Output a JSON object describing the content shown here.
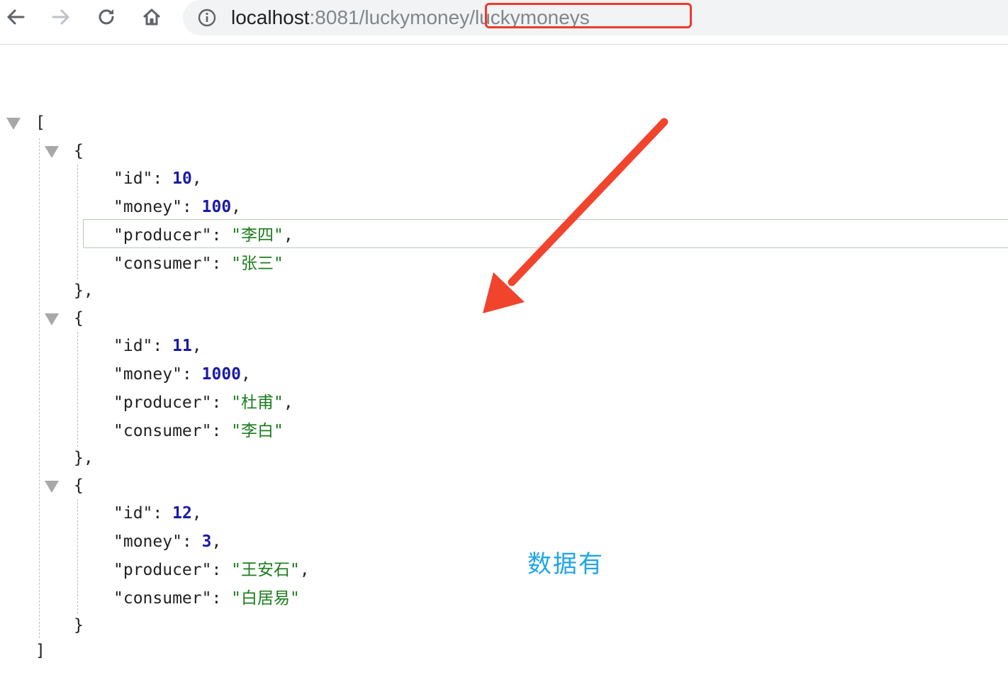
{
  "browser": {
    "url_host": "localhost",
    "url_rest": ":8081/luckymoney/luckymoneys"
  },
  "json": {
    "open_array": "[",
    "close_array": "]",
    "items": [
      {
        "id": "10",
        "money": "100",
        "producer": "\"李四\"",
        "consumer": "\"张三\""
      },
      {
        "id": "11",
        "money": "1000",
        "producer": "\"杜甫\"",
        "consumer": "\"李白\""
      },
      {
        "id": "12",
        "money": "3",
        "producer": "\"王安石\"",
        "consumer": "\"白居易\""
      }
    ],
    "keys": {
      "id": "\"id\": ",
      "money": "\"money\": ",
      "producer": "\"producer\": ",
      "consumer": "\"consumer\": "
    },
    "open_obj": "{",
    "close_obj_comma": "},",
    "close_obj": "}",
    "comma": ","
  },
  "annotation": "数据有",
  "colors": {
    "highlight_box": "#ef3a2b",
    "arrow": "#f1442d",
    "annotation": "#1fa6e6",
    "number": "#1a1aa6",
    "string": "#1c7d1c"
  }
}
